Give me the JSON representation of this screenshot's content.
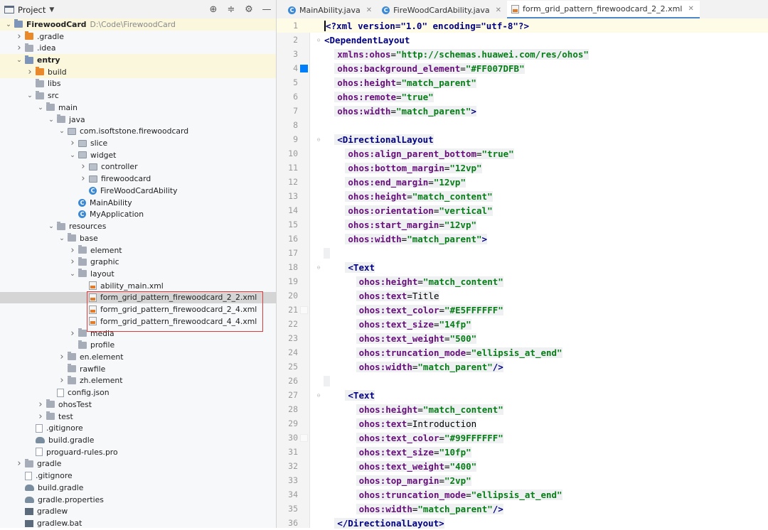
{
  "project_panel": {
    "title": "Project",
    "tree": [
      {
        "depth": 0,
        "open": true,
        "icon": "module",
        "name": "FirewoodCard",
        "bold": true,
        "path": "D:\\Code\\FirewoodCard",
        "hl": "yellow"
      },
      {
        "depth": 1,
        "open": false,
        "icon": "orange",
        "name": ".gradle"
      },
      {
        "depth": 1,
        "open": false,
        "icon": "folder",
        "name": ".idea"
      },
      {
        "depth": 1,
        "open": true,
        "icon": "module",
        "name": "entry",
        "bold": true,
        "hl": "yellow"
      },
      {
        "depth": 2,
        "open": false,
        "icon": "orange",
        "name": "build",
        "hl": "yellow"
      },
      {
        "depth": 2,
        "icon": "folder",
        "name": "libs"
      },
      {
        "depth": 2,
        "open": true,
        "icon": "folder",
        "name": "src"
      },
      {
        "depth": 3,
        "open": true,
        "icon": "folder",
        "name": "main"
      },
      {
        "depth": 4,
        "open": true,
        "icon": "src",
        "name": "java"
      },
      {
        "depth": 5,
        "open": true,
        "icon": "pkg",
        "name": "com.isoftstone.firewoodcard"
      },
      {
        "depth": 6,
        "open": false,
        "icon": "pkg",
        "name": "slice"
      },
      {
        "depth": 6,
        "open": true,
        "icon": "pkg",
        "name": "widget"
      },
      {
        "depth": 7,
        "open": false,
        "icon": "pkg",
        "name": "controller"
      },
      {
        "depth": 7,
        "open": false,
        "icon": "pkg",
        "name": "firewoodcard"
      },
      {
        "depth": 7,
        "icon": "class",
        "name": "FireWoodCardAbility"
      },
      {
        "depth": 6,
        "icon": "class",
        "name": "MainAbility"
      },
      {
        "depth": 6,
        "icon": "class",
        "name": "MyApplication"
      },
      {
        "depth": 4,
        "open": true,
        "icon": "folder",
        "name": "resources"
      },
      {
        "depth": 5,
        "open": true,
        "icon": "folder",
        "name": "base"
      },
      {
        "depth": 6,
        "open": false,
        "icon": "folder",
        "name": "element"
      },
      {
        "depth": 6,
        "open": false,
        "icon": "folder",
        "name": "graphic"
      },
      {
        "depth": 6,
        "open": true,
        "icon": "folder",
        "name": "layout"
      },
      {
        "depth": 7,
        "icon": "xml",
        "name": "ability_main.xml"
      },
      {
        "depth": 7,
        "icon": "xml",
        "name": "form_grid_pattern_firewoodcard_2_2.xml",
        "hl": "sel"
      },
      {
        "depth": 7,
        "icon": "xml",
        "name": "form_grid_pattern_firewoodcard_2_4.xml"
      },
      {
        "depth": 7,
        "icon": "xml",
        "name": "form_grid_pattern_firewoodcard_4_4.xml"
      },
      {
        "depth": 6,
        "open": false,
        "icon": "folder",
        "name": "media"
      },
      {
        "depth": 6,
        "icon": "folder",
        "name": "profile"
      },
      {
        "depth": 5,
        "open": false,
        "icon": "folder",
        "name": "en.element"
      },
      {
        "depth": 5,
        "icon": "folder",
        "name": "rawfile"
      },
      {
        "depth": 5,
        "open": false,
        "icon": "folder",
        "name": "zh.element"
      },
      {
        "depth": 4,
        "icon": "file",
        "name": "config.json"
      },
      {
        "depth": 3,
        "open": false,
        "icon": "folder",
        "name": "ohosTest"
      },
      {
        "depth": 3,
        "open": false,
        "icon": "folder",
        "name": "test"
      },
      {
        "depth": 2,
        "icon": "file",
        "name": ".gitignore"
      },
      {
        "depth": 2,
        "icon": "gradle",
        "name": "build.gradle"
      },
      {
        "depth": 2,
        "icon": "file",
        "name": "proguard-rules.pro"
      },
      {
        "depth": 1,
        "open": false,
        "icon": "folder",
        "name": "gradle"
      },
      {
        "depth": 1,
        "icon": "file",
        "name": ".gitignore"
      },
      {
        "depth": 1,
        "icon": "gradle",
        "name": "build.gradle"
      },
      {
        "depth": 1,
        "icon": "gradle",
        "name": "gradle.properties"
      },
      {
        "depth": 1,
        "icon": "bat",
        "name": "gradlew"
      },
      {
        "depth": 1,
        "icon": "bat",
        "name": "gradlew.bat"
      }
    ]
  },
  "tabs": [
    {
      "label": "MainAbility.java",
      "icon": "class",
      "active": false
    },
    {
      "label": "FireWoodCardAbility.java",
      "icon": "class",
      "active": false
    },
    {
      "label": "form_grid_pattern_firewoodcard_2_2.xml",
      "icon": "xml",
      "active": true
    }
  ],
  "code_lines": [
    {
      "num": "1",
      "indent": 0,
      "tokens": [
        [
          "pi",
          "<?xml version=\"1.0\" encoding=\"utf-8\"?>"
        ]
      ],
      "caret": true
    },
    {
      "num": "2",
      "indent": 0,
      "fold": true,
      "tokens": [
        [
          "tag",
          "<DependentLayout"
        ]
      ]
    },
    {
      "num": "3",
      "indent": 2,
      "tokens": [
        [
          "attr",
          "xmlns:ohos"
        ],
        [
          "plain",
          "="
        ],
        [
          "str",
          "\"http://schemas.huawei.com/res/ohos\""
        ]
      ],
      "tint": true
    },
    {
      "num": "4",
      "indent": 2,
      "swatch": "blue",
      "tokens": [
        [
          "attr",
          "ohos:background_element"
        ],
        [
          "plain",
          "="
        ],
        [
          "str",
          "\"#FF007DFB\""
        ]
      ],
      "tint": true
    },
    {
      "num": "5",
      "indent": 2,
      "tokens": [
        [
          "attr",
          "ohos:height"
        ],
        [
          "plain",
          "="
        ],
        [
          "str",
          "\"match_parent\""
        ]
      ],
      "tint": true
    },
    {
      "num": "6",
      "indent": 2,
      "tokens": [
        [
          "attr",
          "ohos:remote"
        ],
        [
          "plain",
          "="
        ],
        [
          "str",
          "\"true\""
        ]
      ],
      "tint": true
    },
    {
      "num": "7",
      "indent": 2,
      "tokens": [
        [
          "attr",
          "ohos:width"
        ],
        [
          "plain",
          "="
        ],
        [
          "str",
          "\"match_parent\""
        ],
        [
          "tag",
          ">"
        ]
      ],
      "tint": true
    },
    {
      "num": "8",
      "indent": 0,
      "tokens": []
    },
    {
      "num": "9",
      "indent": 2,
      "fold": true,
      "tokens": [
        [
          "tag",
          "<DirectionalLayout"
        ]
      ],
      "tint": true
    },
    {
      "num": "10",
      "indent": 4,
      "tokens": [
        [
          "attr",
          "ohos:align_parent_bottom"
        ],
        [
          "plain",
          "="
        ],
        [
          "str",
          "\"true\""
        ]
      ],
      "tint": true
    },
    {
      "num": "11",
      "indent": 4,
      "tokens": [
        [
          "attr",
          "ohos:bottom_margin"
        ],
        [
          "plain",
          "="
        ],
        [
          "str",
          "\"12vp\""
        ]
      ],
      "tint": true
    },
    {
      "num": "12",
      "indent": 4,
      "tokens": [
        [
          "attr",
          "ohos:end_margin"
        ],
        [
          "plain",
          "="
        ],
        [
          "str",
          "\"12vp\""
        ]
      ],
      "tint": true
    },
    {
      "num": "13",
      "indent": 4,
      "tokens": [
        [
          "attr",
          "ohos:height"
        ],
        [
          "plain",
          "="
        ],
        [
          "str",
          "\"match_content\""
        ]
      ],
      "tint": true
    },
    {
      "num": "14",
      "indent": 4,
      "tokens": [
        [
          "attr",
          "ohos:orientation"
        ],
        [
          "plain",
          "="
        ],
        [
          "str",
          "\"vertical\""
        ]
      ],
      "tint": true
    },
    {
      "num": "15",
      "indent": 4,
      "tokens": [
        [
          "attr",
          "ohos:start_margin"
        ],
        [
          "plain",
          "="
        ],
        [
          "str",
          "\"12vp\""
        ]
      ],
      "tint": true
    },
    {
      "num": "16",
      "indent": 4,
      "tokens": [
        [
          "attr",
          "ohos:width"
        ],
        [
          "plain",
          "="
        ],
        [
          "str",
          "\"match_parent\""
        ],
        [
          "tag",
          ">"
        ]
      ],
      "tint": true
    },
    {
      "num": "17",
      "indent": 0,
      "tokens": [],
      "tint": true
    },
    {
      "num": "18",
      "indent": 4,
      "fold": true,
      "tokens": [
        [
          "tag",
          "<Text"
        ]
      ],
      "tint": true
    },
    {
      "num": "19",
      "indent": 6,
      "tokens": [
        [
          "attr",
          "ohos:height"
        ],
        [
          "plain",
          "="
        ],
        [
          "str",
          "\"match_content\""
        ]
      ],
      "tint": true
    },
    {
      "num": "20",
      "indent": 6,
      "tokens": [
        [
          "attr",
          "ohos:text"
        ],
        [
          "plain",
          "="
        ],
        [
          "lit",
          "Title"
        ]
      ],
      "tint": true
    },
    {
      "num": "21",
      "indent": 6,
      "swatch": "white",
      "tokens": [
        [
          "attr",
          "ohos:text_color"
        ],
        [
          "plain",
          "="
        ],
        [
          "str",
          "\"#E5FFFFFF\""
        ]
      ],
      "tint": true
    },
    {
      "num": "22",
      "indent": 6,
      "tokens": [
        [
          "attr",
          "ohos:text_size"
        ],
        [
          "plain",
          "="
        ],
        [
          "str",
          "\"14fp\""
        ]
      ],
      "tint": true
    },
    {
      "num": "23",
      "indent": 6,
      "tokens": [
        [
          "attr",
          "ohos:text_weight"
        ],
        [
          "plain",
          "="
        ],
        [
          "str",
          "\"500\""
        ]
      ],
      "tint": true
    },
    {
      "num": "24",
      "indent": 6,
      "tokens": [
        [
          "attr",
          "ohos:truncation_mode"
        ],
        [
          "plain",
          "="
        ],
        [
          "str",
          "\"ellipsis_at_end\""
        ]
      ],
      "tint": true
    },
    {
      "num": "25",
      "indent": 6,
      "tokens": [
        [
          "attr",
          "ohos:width"
        ],
        [
          "plain",
          "="
        ],
        [
          "str",
          "\"match_parent\""
        ],
        [
          "tag",
          "/>"
        ]
      ],
      "tint": true
    },
    {
      "num": "26",
      "indent": 0,
      "tokens": [],
      "tint": true
    },
    {
      "num": "27",
      "indent": 4,
      "fold": true,
      "tokens": [
        [
          "tag",
          "<Text"
        ]
      ],
      "tint": true
    },
    {
      "num": "28",
      "indent": 6,
      "tokens": [
        [
          "attr",
          "ohos:height"
        ],
        [
          "plain",
          "="
        ],
        [
          "str",
          "\"match_content\""
        ]
      ],
      "tint": true
    },
    {
      "num": "29",
      "indent": 6,
      "tokens": [
        [
          "attr",
          "ohos:text"
        ],
        [
          "plain",
          "="
        ],
        [
          "lit",
          "Introduction"
        ]
      ],
      "tint": true
    },
    {
      "num": "30",
      "indent": 6,
      "swatch": "white",
      "tokens": [
        [
          "attr",
          "ohos:text_color"
        ],
        [
          "plain",
          "="
        ],
        [
          "str",
          "\"#99FFFFFF\""
        ]
      ],
      "tint": true
    },
    {
      "num": "31",
      "indent": 6,
      "tokens": [
        [
          "attr",
          "ohos:text_size"
        ],
        [
          "plain",
          "="
        ],
        [
          "str",
          "\"10fp\""
        ]
      ],
      "tint": true
    },
    {
      "num": "32",
      "indent": 6,
      "tokens": [
        [
          "attr",
          "ohos:text_weight"
        ],
        [
          "plain",
          "="
        ],
        [
          "str",
          "\"400\""
        ]
      ],
      "tint": true
    },
    {
      "num": "33",
      "indent": 6,
      "tokens": [
        [
          "attr",
          "ohos:top_margin"
        ],
        [
          "plain",
          "="
        ],
        [
          "str",
          "\"2vp\""
        ]
      ],
      "tint": true
    },
    {
      "num": "34",
      "indent": 6,
      "tokens": [
        [
          "attr",
          "ohos:truncation_mode"
        ],
        [
          "plain",
          "="
        ],
        [
          "str",
          "\"ellipsis_at_end\""
        ]
      ],
      "tint": true
    },
    {
      "num": "35",
      "indent": 6,
      "tokens": [
        [
          "attr",
          "ohos:width"
        ],
        [
          "plain",
          "="
        ],
        [
          "str",
          "\"match_parent\""
        ],
        [
          "tag",
          "/>"
        ]
      ],
      "tint": true
    },
    {
      "num": "36",
      "indent": 2,
      "tokens": [
        [
          "tag",
          "</DirectionalLayout>"
        ]
      ],
      "tint": true
    }
  ],
  "colors": {
    "accent": "#4a86c8",
    "swatch_bg": "#007dfb",
    "annotation_box": "#e0393b"
  }
}
